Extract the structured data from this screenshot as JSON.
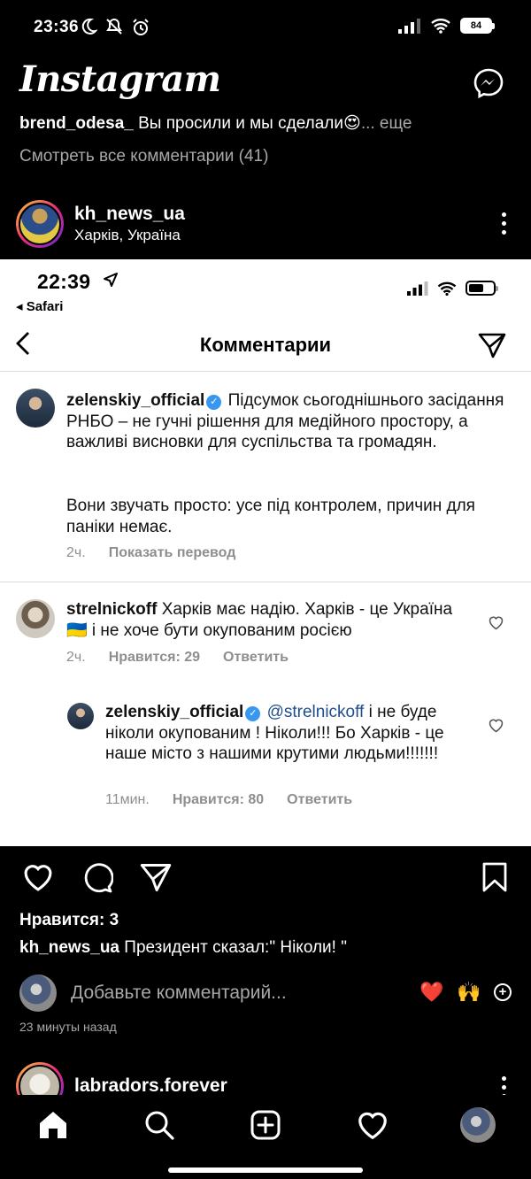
{
  "status_bar": {
    "time": "23:36",
    "battery": "84",
    "icons": [
      "moon-icon",
      "mute-icon",
      "alarm-icon",
      "signal-icon",
      "wifi-icon",
      "battery-icon"
    ]
  },
  "header": {
    "logo": "Instagram",
    "messenger_icon": "messenger-icon"
  },
  "previous_post": {
    "comment_user": "brend_odesa_",
    "comment_text": "Вы просили и мы сделали😍",
    "more": "... еще",
    "view_all": "Смотреть все комментарии (41)"
  },
  "post": {
    "username": "kh_news_ua",
    "location": "Харків, Україна",
    "image": {
      "status_time": "22:39",
      "back_app": "◂ Safari",
      "title": "Комментарии",
      "comments": [
        {
          "username": "zelenskiy_official",
          "text_1": "Підсумок сьогоднішнього засідання РНБО – не гучні рішення для медійного простору, а важливі висновки для суспільства та громадян.",
          "text_2": "Вони звучать просто: усе під контролем, причин для паніки немає.",
          "time": "2ч.",
          "translate": "Показать перевод"
        },
        {
          "username": "strelnickoff",
          "text": "Харків має надію. Харків - це Україна🇺🇦 і не хоче бути окупованим росією",
          "time": "2ч.",
          "likes": "Нравится: 29",
          "reply": "Ответить"
        },
        {
          "username": "zelenskiy_official",
          "mention": "@strelnickoff",
          "text": "і не буде ніколи окупованим ! Ніколи!!! Бо Харків - це наше місто з нашими крутими людьми!!!!!!!",
          "time": "11мин.",
          "likes": "Нравится: 80",
          "reply": "Ответить"
        }
      ]
    },
    "likes": "Нравится: 3",
    "caption_user": "kh_news_ua",
    "caption_text": "Президент сказал:\" Ніколи! \"",
    "add_comment_placeholder": "Добавьте комментарий...",
    "quick_emojis": [
      "❤️",
      "🙌",
      "+"
    ],
    "time_ago": "23 минуты назад"
  },
  "next_post": {
    "username": "labradors.forever"
  },
  "bottom_nav": [
    "home-icon",
    "search-icon",
    "create-icon",
    "activity-icon",
    "profile-avatar"
  ],
  "colors": {
    "background": "#000000",
    "secondary_text": "#a8a8a8",
    "verified": "#3897f0",
    "mention": "#1f4e8c",
    "like_heart": "#ed2c3e"
  }
}
